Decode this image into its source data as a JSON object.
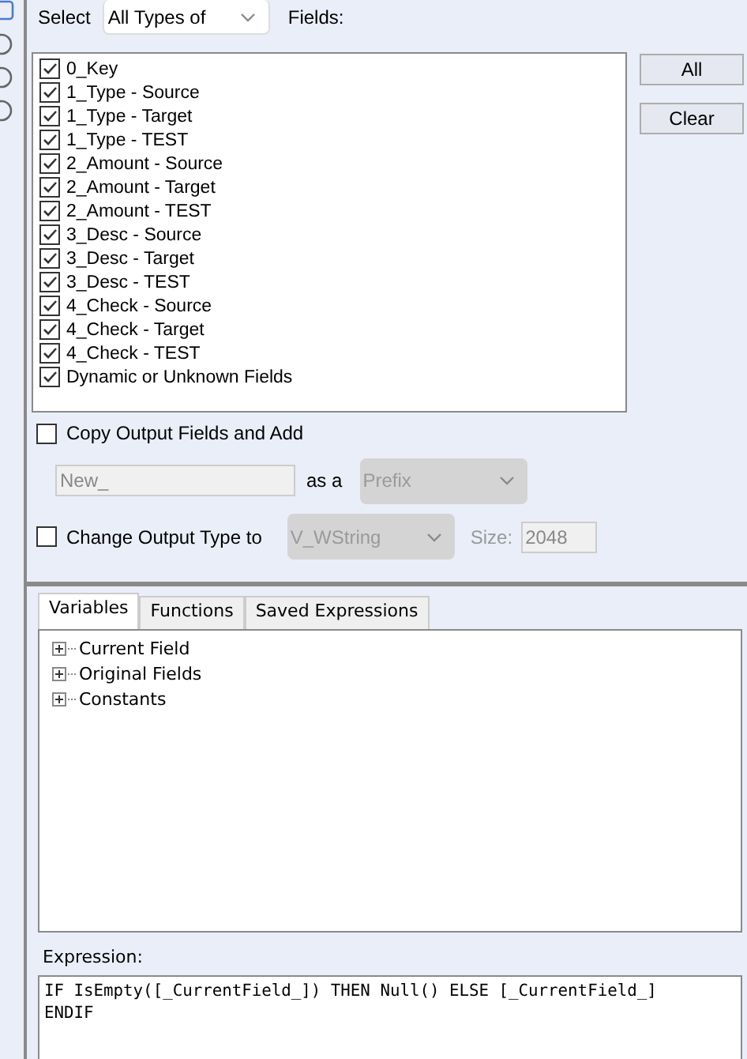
{
  "select": {
    "label": "Select",
    "value": "All Types of"
  },
  "fields_label": "Fields:",
  "fields": [
    {
      "label": "0_Key",
      "checked": true
    },
    {
      "label": "1_Type - Source",
      "checked": true
    },
    {
      "label": "1_Type - Target",
      "checked": true
    },
    {
      "label": "1_Type - TEST",
      "checked": true
    },
    {
      "label": "2_Amount - Source",
      "checked": true
    },
    {
      "label": "2_Amount - Target",
      "checked": true
    },
    {
      "label": "2_Amount - TEST",
      "checked": true
    },
    {
      "label": "3_Desc - Source",
      "checked": true
    },
    {
      "label": "3_Desc - Target",
      "checked": true
    },
    {
      "label": "3_Desc - TEST",
      "checked": true
    },
    {
      "label": "4_Check - Source",
      "checked": true
    },
    {
      "label": "4_Check - Target",
      "checked": true
    },
    {
      "label": "4_Check - TEST",
      "checked": true
    },
    {
      "label": "Dynamic or Unknown Fields",
      "checked": true
    }
  ],
  "buttons": [
    "All",
    "Clear"
  ],
  "copy_output": {
    "label": "Copy Output Fields and Add",
    "checked": false,
    "value": "New_",
    "as_label": "as a",
    "mode": "Prefix",
    "disabled": true
  },
  "change_type": {
    "label": "Change Output Type to",
    "checked": false,
    "type": "V_WString",
    "size_label": "Size:",
    "size": "2048",
    "disabled": true
  },
  "tabs": [
    {
      "label": "Variables",
      "selected": true
    },
    {
      "label": "Functions",
      "selected": false
    },
    {
      "label": "Saved Expressions",
      "selected": false
    }
  ],
  "tree": [
    {
      "label": "Current Field",
      "expanded": false
    },
    {
      "label": "Original Fields",
      "expanded": false
    },
    {
      "label": "Constants",
      "expanded": false
    }
  ],
  "expression": {
    "label": "Expression:",
    "lines": [
      "IF IsEmpty([_CurrentField_]) THEN Null() ELSE [_CurrentField_]",
      "ENDIF"
    ]
  }
}
